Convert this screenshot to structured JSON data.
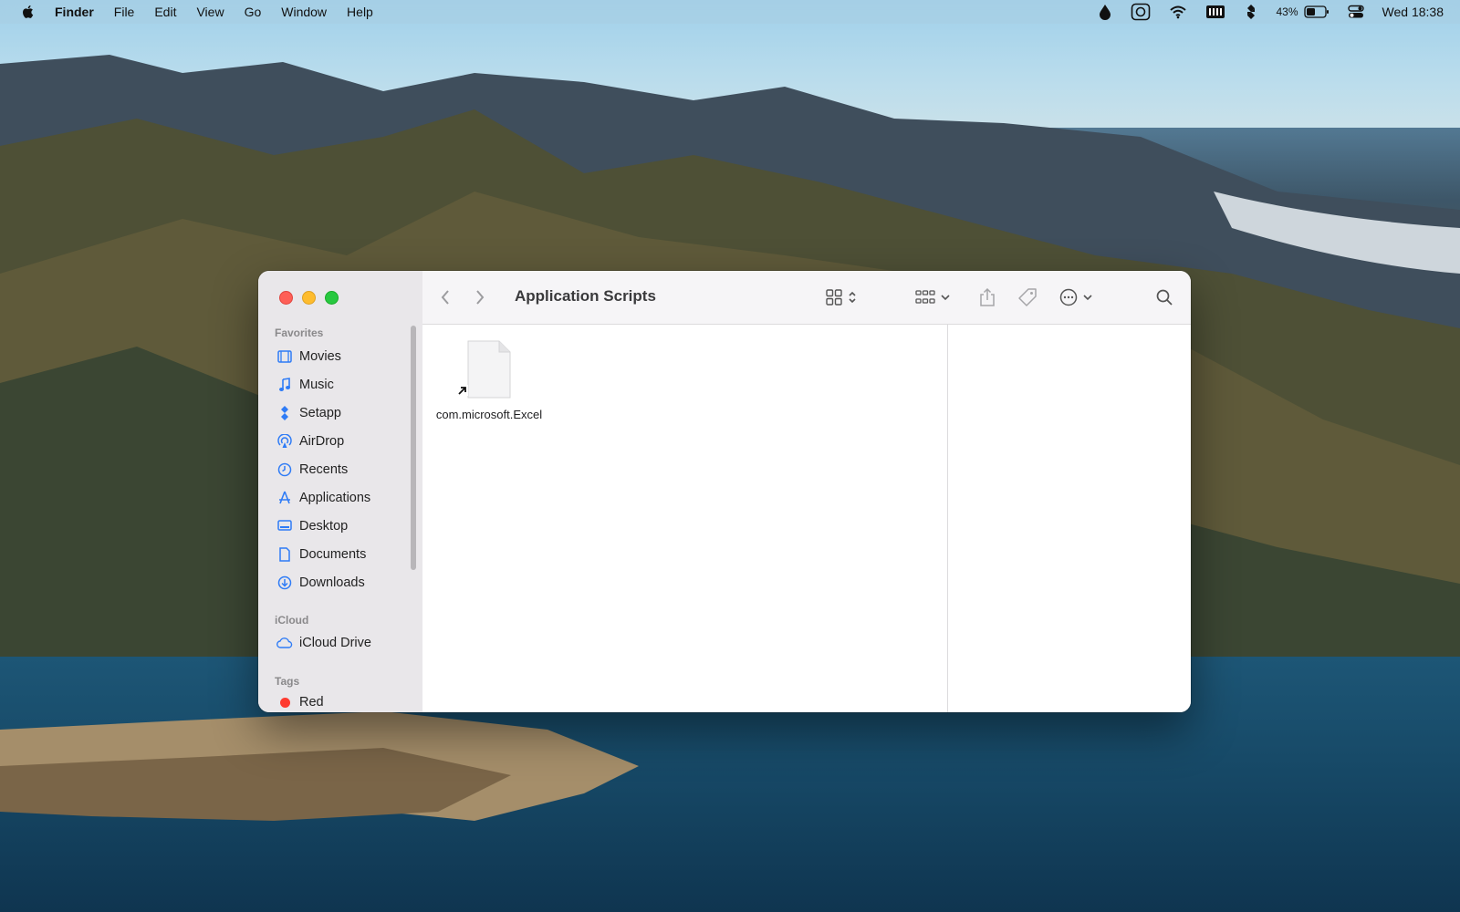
{
  "menubar": {
    "app_name": "Finder",
    "items": [
      "File",
      "Edit",
      "View",
      "Go",
      "Window",
      "Help"
    ],
    "battery_percent": "43%",
    "clock": "Wed 18:38",
    "status_icons": [
      "drop-icon",
      "screenshot-icon",
      "wifi-icon",
      "keyboard-icon",
      "setapp-icon",
      "battery-icon",
      "control-center-icon"
    ]
  },
  "window": {
    "title": "Application Scripts",
    "sidebar": {
      "favorites_header": "Favorites",
      "favorites": [
        {
          "label": "Movies",
          "icon": "film-icon"
        },
        {
          "label": "Music",
          "icon": "music-note-icon"
        },
        {
          "label": "Setapp",
          "icon": "setapp-icon"
        },
        {
          "label": "AirDrop",
          "icon": "airdrop-icon"
        },
        {
          "label": "Recents",
          "icon": "clock-icon"
        },
        {
          "label": "Applications",
          "icon": "applications-icon"
        },
        {
          "label": "Desktop",
          "icon": "desktop-icon"
        },
        {
          "label": "Documents",
          "icon": "document-icon"
        },
        {
          "label": "Downloads",
          "icon": "download-icon"
        }
      ],
      "icloud_header": "iCloud",
      "icloud": [
        {
          "label": "iCloud Drive",
          "icon": "cloud-icon"
        }
      ],
      "tags_header": "Tags",
      "tags": [
        {
          "label": "Red",
          "color": "#fe3b30"
        }
      ]
    },
    "files": [
      {
        "name": "com.microsoft.Excel",
        "icon": "alias-file-icon"
      }
    ]
  },
  "colors": {
    "accent": "#2f7cf6",
    "close": "#fe5f57",
    "minimize": "#febc2e",
    "maximize": "#28c840"
  }
}
